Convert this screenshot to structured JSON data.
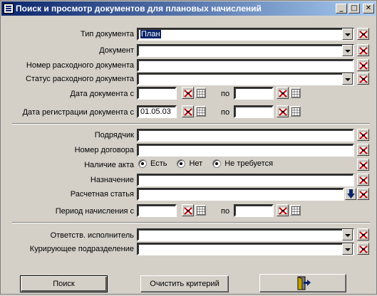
{
  "window": {
    "title": "Поиск и просмотр документов для плановых начислений",
    "minimize": "_",
    "maximize": "□",
    "close": "✕"
  },
  "form": {
    "doc_type_label": "Тип документа",
    "doc_type_value": "План",
    "document_label": "Документ",
    "document_value": "",
    "expense_doc_number_label": "Номер расходного документа",
    "expense_doc_number_value": "",
    "expense_doc_status_label": "Статус расходного документа",
    "expense_doc_status_value": "",
    "doc_date_label": "Дата документа  с",
    "doc_date_from": "",
    "doc_date_to_label": "по",
    "doc_date_to": "",
    "reg_date_label": "Дата регистрации документа с",
    "reg_date_from": "01.05.03",
    "reg_date_to_label": "по",
    "reg_date_to": "",
    "contractor_label": "Подрядчик",
    "contractor_value": "",
    "contract_number_label": "Номер договора",
    "contract_number_value": "",
    "act_label": "Наличие акта",
    "act_options": [
      "Есть",
      "Нет",
      "Не требуется"
    ],
    "purpose_label": "Назначение",
    "purpose_value": "",
    "account_item_label": "Расчетная статья",
    "account_item_value": "",
    "period_label": "Период начисления с",
    "period_from": "",
    "period_to_label": "по",
    "period_to": "",
    "executor_label": "Ответств. исполнитель",
    "executor_value": "",
    "department_label": "Курирующее подразделение",
    "department_value": ""
  },
  "buttons": {
    "search": "Поиск",
    "clear_criteria": "Очистить критерий",
    "exit_icon": "exit-door-icon"
  },
  "colors": {
    "title_start": "#0a246a",
    "title_end": "#a6caf0",
    "face": "#d4d0c8"
  }
}
